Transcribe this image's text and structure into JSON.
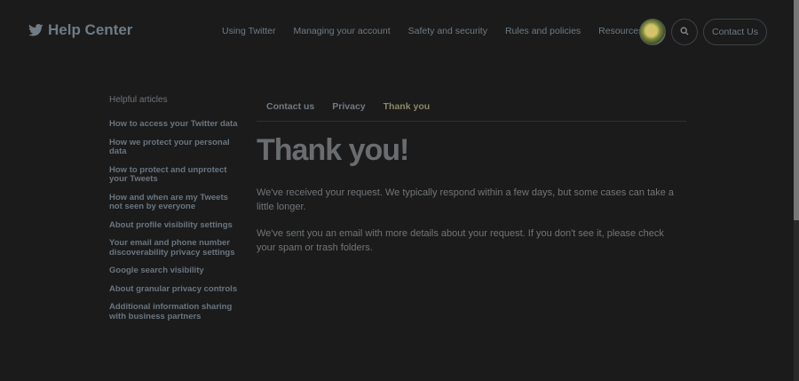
{
  "header": {
    "logo_text": "Help Center",
    "nav": [
      "Using Twitter",
      "Managing your account",
      "Safety and security",
      "Rules and policies"
    ],
    "resources_label": "Resources",
    "contact_button": "Contact Us",
    "icons": {
      "logo": "twitter-bird-icon",
      "search": "search-icon",
      "resources": "chevron-down-icon"
    }
  },
  "sidebar": {
    "heading": "Helpful articles",
    "items": [
      "How to access your Twitter data",
      "How we protect your personal data",
      "How to protect and unprotect your Tweets",
      "How and when are my Tweets not seen by everyone",
      "About profile visibility settings",
      "Your email and phone number discoverability privacy settings",
      "Google search visibility",
      "About granular privacy controls",
      "Additional information sharing with business partners"
    ]
  },
  "breadcrumbs": [
    "Contact us",
    "Privacy",
    "Thank you"
  ],
  "main": {
    "title": "Thank you!",
    "para1": "We've received your request. We typically respond within a few days, but some cases can take a little longer.",
    "para2": "We've sent you an email with more details about your request. If you don't see it, please check your spam or trash folders."
  },
  "colors": {
    "background": "#1b1b1b",
    "link": "#6f7b85",
    "active_tab": "#8a8866"
  }
}
